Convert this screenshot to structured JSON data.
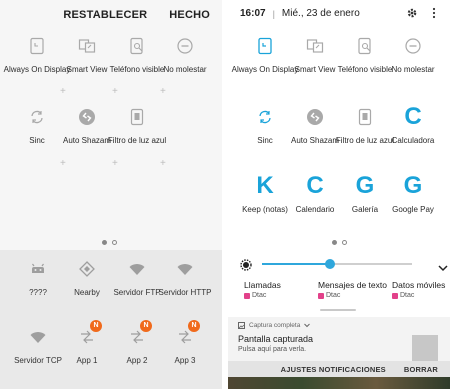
{
  "left": {
    "actions": [
      "RESTABLECER",
      "HECHO"
    ],
    "tiles": [
      {
        "label": "Always On Display",
        "icon": "always-on-display-icon"
      },
      {
        "label": "Smart View",
        "icon": "smart-view-icon"
      },
      {
        "label": "Teléfono visible",
        "icon": "phone-visible-icon"
      },
      {
        "label": "No molestar",
        "icon": "do-not-disturb-icon"
      },
      {
        "label": "Sinc",
        "icon": "sync-icon"
      },
      {
        "label": "Auto Shazam",
        "icon": "shazam-icon"
      },
      {
        "label": "Filtro de luz azul",
        "icon": "blue-light-filter-icon"
      }
    ],
    "tray_tiles": [
      {
        "label": "????",
        "icon": "android-icon"
      },
      {
        "label": "Nearby",
        "icon": "nearby-icon"
      },
      {
        "label": "Servidor FTP",
        "icon": "wifi-icon"
      },
      {
        "label": "Servidor HTTP",
        "icon": "wifi-icon"
      },
      {
        "label": "Servidor TCP",
        "icon": "wifi-icon"
      },
      {
        "label": "App 1",
        "icon": "app-shortcut-icon",
        "badge": "N"
      },
      {
        "label": "App 2",
        "icon": "app-shortcut-icon",
        "badge": "N"
      },
      {
        "label": "App 3",
        "icon": "app-shortcut-icon",
        "badge": "N"
      }
    ]
  },
  "right": {
    "status": {
      "time": "16:07",
      "date": "Mié., 23 de enero"
    },
    "tiles": [
      {
        "label": "Always On Display",
        "icon": "always-on-display-icon"
      },
      {
        "label": "Smart View",
        "icon": "smart-view-icon"
      },
      {
        "label": "Teléfono visible",
        "icon": "phone-visible-icon"
      },
      {
        "label": "No molestar",
        "icon": "do-not-disturb-icon"
      },
      {
        "label": "Sinc",
        "icon": "sync-icon"
      },
      {
        "label": "Auto Shazam",
        "icon": "shazam-icon"
      },
      {
        "label": "Filtro de luz azul",
        "icon": "blue-light-filter-icon"
      },
      {
        "label": "Calculadora",
        "letter": "C"
      },
      {
        "label": "Keep (notas)",
        "letter": "K"
      },
      {
        "label": "Calendario",
        "letter": "C"
      },
      {
        "label": "Galería",
        "letter": "G"
      },
      {
        "label": "Google Pay",
        "letter": "G"
      }
    ],
    "brightness": {
      "level": 0.45
    },
    "usage": [
      {
        "title": "Llamadas",
        "sim": "Dtac"
      },
      {
        "title": "Mensajes de texto",
        "sim": "Dtac"
      },
      {
        "title": "Datos móviles",
        "sim": "Dtac"
      }
    ],
    "notification": {
      "header": "Captura completa",
      "title": "Pantalla capturada",
      "body": "Pulsa aquí para verla."
    },
    "bottom": {
      "settings": "AJUSTES NOTIFICACIONES",
      "clear": "BORRAR"
    }
  },
  "colors": {
    "accent": "#1aa3d9",
    "badge": "#f06a1c",
    "sim": "#e2418a"
  }
}
